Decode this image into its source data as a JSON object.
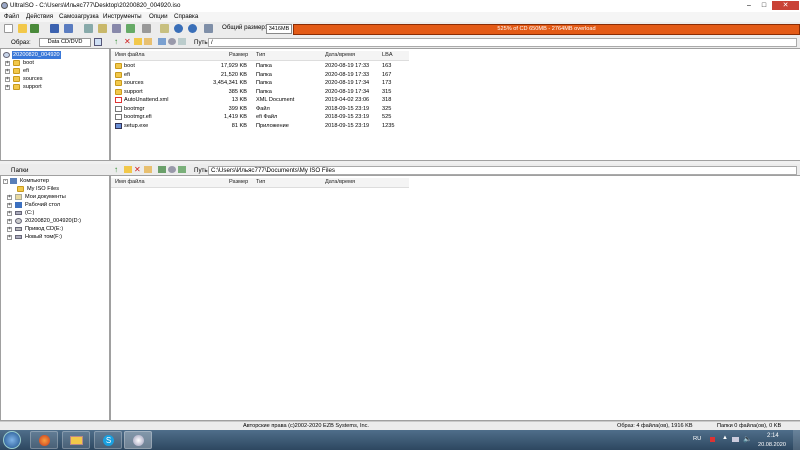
{
  "window": {
    "title": "UltraISO - C:\\Users\\Ильяс777\\Desktop\\20200820_004920.iso"
  },
  "menu": [
    "Файл",
    "Действия",
    "Самозагрузка",
    "Инструменты",
    "Опции",
    "Справка"
  ],
  "toolbar": {
    "size_label": "Общий размер:",
    "size_value": "3416MB",
    "capacity_text": "525% of CD 650MB - 2764MB overload"
  },
  "image_panel": {
    "label": "Образ:",
    "type_value": "Data CD/DVD",
    "path_label": "Путь:",
    "path_value": "/"
  },
  "iso_tree": {
    "root": "20200820_004920",
    "items": [
      "boot",
      "efi",
      "sources",
      "support"
    ]
  },
  "columns": {
    "name": "Имя файла",
    "size": "Размер",
    "type": "Тип",
    "date": "Дата/время",
    "lba": "LBA"
  },
  "iso_files": [
    {
      "name": "boot",
      "size": "17,929 KB",
      "type": "Папка",
      "date": "2020-08-19 17:33",
      "lba": "163",
      "icon": "folder"
    },
    {
      "name": "efi",
      "size": "21,520 KB",
      "type": "Папка",
      "date": "2020-08-19 17:33",
      "lba": "167",
      "icon": "folder"
    },
    {
      "name": "sources",
      "size": "3,454,341 KB",
      "type": "Папка",
      "date": "2020-08-19 17:34",
      "lba": "173",
      "icon": "folder"
    },
    {
      "name": "support",
      "size": "385 KB",
      "type": "Папка",
      "date": "2020-08-19 17:34",
      "lba": "315",
      "icon": "folder"
    },
    {
      "name": "AutoUnattend.xml",
      "size": "13 KB",
      "type": "XML Document",
      "date": "2019-04-02 23:06",
      "lba": "318",
      "icon": "xml"
    },
    {
      "name": "bootmgr",
      "size": "399 KB",
      "type": "Файл",
      "date": "2018-09-15 23:19",
      "lba": "325",
      "icon": "doc"
    },
    {
      "name": "bootmgr.efi",
      "size": "1,419 KB",
      "type": "efi Файл",
      "date": "2018-09-15 23:19",
      "lba": "525",
      "icon": "doc"
    },
    {
      "name": "setup.exe",
      "size": "81 KB",
      "type": "Приложение",
      "date": "2018-09-15 23:19",
      "lba": "1235",
      "icon": "exe"
    }
  ],
  "local_panel": {
    "label": "Папки",
    "path_label": "Путь:",
    "path_value": "C:\\Users\\Ильяс777\\Documents\\My ISO Files"
  },
  "local_tree": [
    "Компьютер",
    "My ISO Files",
    "Мои документы",
    "Рабочий стол",
    "(C:)",
    "20200820_004920(D:)",
    "Привод CD(E:)",
    "Новый том(F:)"
  ],
  "status": {
    "copyright": "Авторские права (c)2002-2020 EZB Systems, Inc.",
    "image_info": "Образ: 4 файла(ов), 1916 KB",
    "local_info": "Папки 0 файла(ов), 0 KB"
  },
  "taskbar": {
    "lang": "RU",
    "time": "2:14",
    "date": "20.08.2020"
  }
}
